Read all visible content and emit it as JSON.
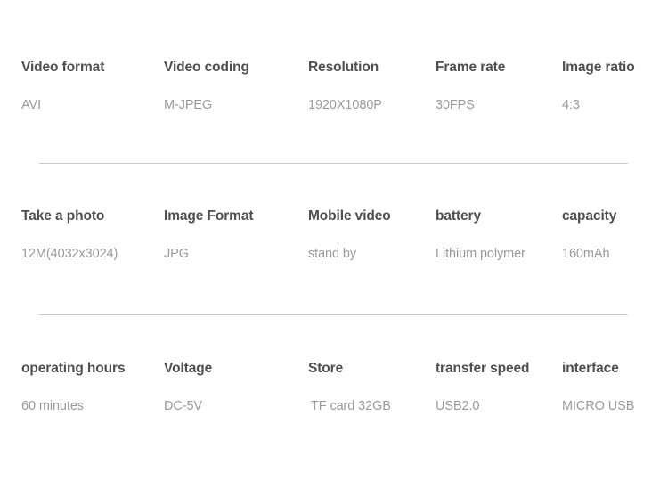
{
  "page": {
    "title": "Product Specification Table",
    "background_color": "#ffffff",
    "header_text_color": "#4f4f4f",
    "value_text_color": "#9a9a9a",
    "divider_color": "#c9c9c9"
  },
  "spec_blocks": [
    {
      "id": "video-specs",
      "columns": [
        {
          "header": "Video format",
          "value": "AVI"
        },
        {
          "header": "Video coding",
          "value": "M-JPEG"
        },
        {
          "header": "Resolution",
          "value": "1920X1080P"
        },
        {
          "header": "Frame rate",
          "value": "30FPS"
        },
        {
          "header": "Image ratio",
          "value": "4:3"
        }
      ]
    },
    {
      "id": "photo-power-specs",
      "columns": [
        {
          "header": "Take a photo",
          "value": "12M(4032x3024)"
        },
        {
          "header": "Image Format",
          "value": "JPG"
        },
        {
          "header": "Mobile video",
          "value": "stand by"
        },
        {
          "header": "battery",
          "value": "Lithium polymer"
        },
        {
          "header": "capacity",
          "value": "160mAh"
        }
      ]
    },
    {
      "id": "operation-storage-specs",
      "columns": [
        {
          "header": "operating hours",
          "value": "60 minutes"
        },
        {
          "header": "Voltage",
          "value": "DC-5V"
        },
        {
          "header": "Store",
          "value": "TF card 32GB"
        },
        {
          "header": "transfer speed",
          "value": "USB2.0"
        },
        {
          "header": "interface",
          "value": "MICRO USB"
        }
      ]
    }
  ]
}
